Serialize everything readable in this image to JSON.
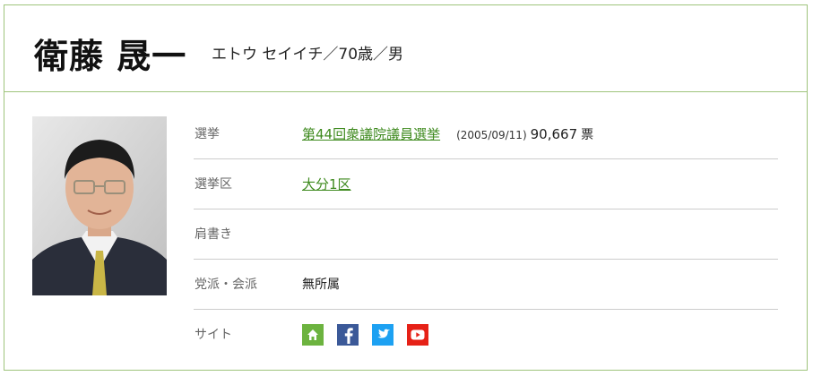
{
  "profile": {
    "name": "衛藤 晟一",
    "kana_age_gender": "エトウ セイイチ／70歳／男"
  },
  "rows": {
    "election": {
      "label": "選挙",
      "election_link": "第44回衆議院議員選挙",
      "date": "(2005/09/11)",
      "votes": "90,667",
      "votes_unit": "票"
    },
    "district": {
      "label": "選挙区",
      "value": "大分1区"
    },
    "title": {
      "label": "肩書き",
      "value": ""
    },
    "party": {
      "label": "党派・会派",
      "value": "無所属"
    },
    "sites": {
      "label": "サイト",
      "icons": [
        "home-icon",
        "facebook-icon",
        "twitter-icon",
        "youtube-icon"
      ]
    }
  },
  "colors": {
    "accent_border": "#9fc47c",
    "link": "#3e8a1e",
    "home": "#6cb33f",
    "facebook": "#3b5998",
    "twitter": "#1da1f2",
    "youtube": "#e62117"
  }
}
